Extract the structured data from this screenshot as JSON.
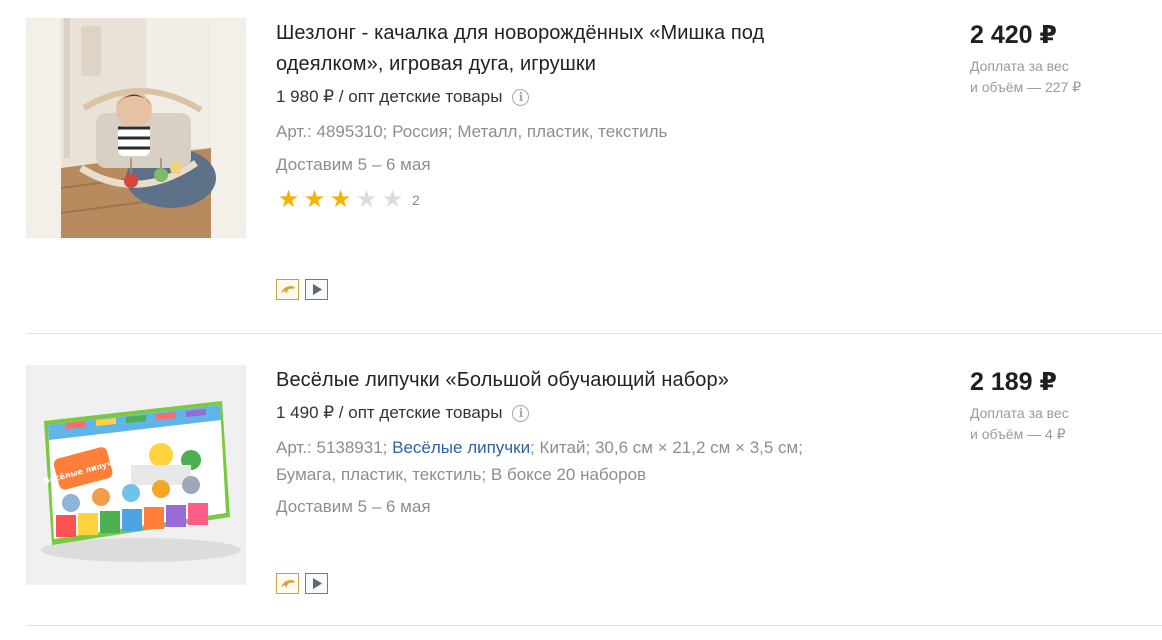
{
  "products": [
    {
      "title": "Шезлонг - качалка для новорождённых «Мишка под одеялком», игровая дуга, игрушки",
      "wholesale_price": "1 980 ₽ / опт детские товары",
      "meta": "Арт.: 4895310; Россия; Металл, пластик, текстиль",
      "delivery": "Доставим 5 – 6 мая",
      "rating": 3,
      "rating_max": 5,
      "reviews": "2",
      "price": "2 420 ₽",
      "extra_line1": "Доплата за вес",
      "extra_line2": "и объём — 227 ₽",
      "badges": [
        "dolphin-icon",
        "play-icon"
      ]
    },
    {
      "title": "Весёлые липучки «Большой обучающий набор»",
      "wholesale_price": "1 490 ₽ / опт детские товары",
      "meta_prefix": "Арт.: 5138931; ",
      "meta_link": "Весёлые липучки",
      "meta_suffix": "; Китай; 30,6 см × 21,2 см × 3,5 см;",
      "meta_line2": "Бумага, пластик, текстиль; В боксе 20 наборов",
      "delivery": "Доставим 5 – 6 мая",
      "price": "2 189 ₽",
      "extra_line1": "Доплата за вес",
      "extra_line2": "и объём — 4 ₽",
      "box_logo": "Весёлые липучки",
      "badges": [
        "dolphin-icon",
        "play-icon"
      ]
    }
  ],
  "colors": {
    "star": "#f5b300",
    "link": "#2b63a6",
    "muted": "#8e8e8e"
  }
}
